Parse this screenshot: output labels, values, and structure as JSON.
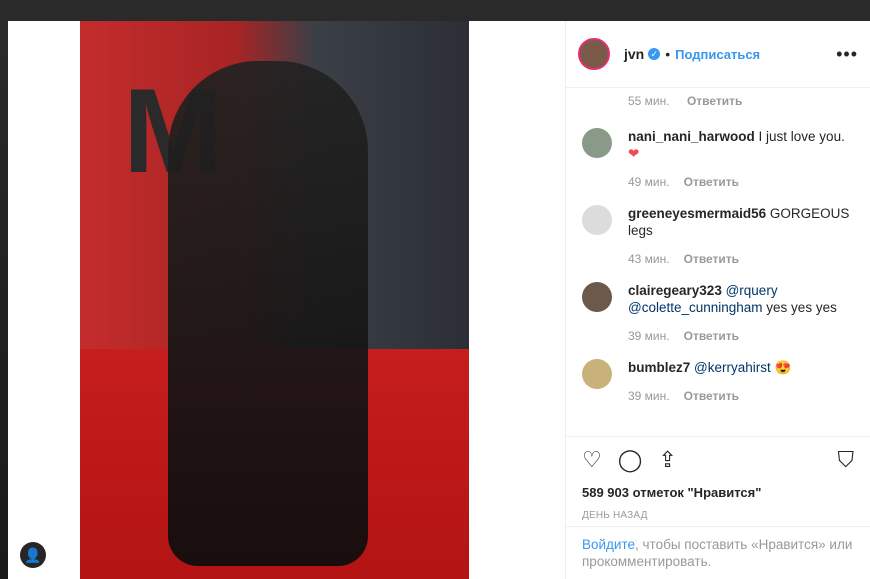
{
  "header": {
    "username": "jvn",
    "verified_icon": "verified-badge-icon",
    "separator": "•",
    "follow_label": "Подписаться",
    "more_icon": "more-options-icon"
  },
  "first_comment_meta": {
    "time": "55 мин.",
    "reply": "Ответить"
  },
  "comments": [
    {
      "user": "nani_nani_harwood",
      "text": " I just love you.",
      "emoji": "❤",
      "time": "49 мин.",
      "reply": "Ответить"
    },
    {
      "user": "greeneyesmermaid56",
      "text": " GORGEOUS legs",
      "time": "43 мин.",
      "reply": "Ответить"
    },
    {
      "user": "clairegeary323",
      "mention1": "@rquery",
      "mention2": "@colette_cunningham",
      "text": " yes yes yes",
      "time": "39 мин.",
      "reply": "Ответить"
    },
    {
      "user": "bumblez7",
      "mention1": "@kerryahirst",
      "emoji": "😍",
      "time": "39 мин.",
      "reply": "Ответить"
    }
  ],
  "actions": {
    "like_icon": "heart-icon",
    "comment_icon": "comment-icon",
    "share_icon": "share-icon",
    "save_icon": "bookmark-icon",
    "likes_text": "589 903 отметок \"Нравится\"",
    "posted_ago": "ДЕНЬ НАЗАД"
  },
  "login_prompt": {
    "link": "Войдите",
    "rest": ", чтобы поставить «Нравится» или прокомментировать."
  },
  "photo": {
    "logo_text": "M"
  },
  "colors": {
    "accent": "#3897f0",
    "text": "#262626",
    "muted": "#999999",
    "heart": "#ed4956"
  }
}
